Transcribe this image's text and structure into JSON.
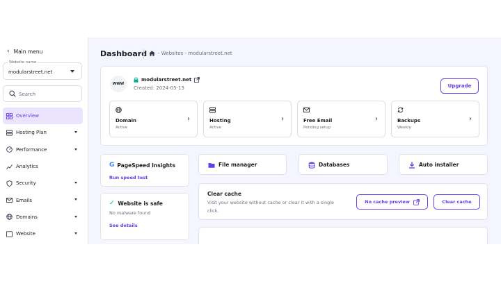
{
  "sidebar": {
    "main_menu": "Main menu",
    "website_select": {
      "label": "Website name",
      "value": "modularstreet.net"
    },
    "search": {
      "placeholder": "Search"
    },
    "items": [
      {
        "label": "Overview",
        "icon": "grid-icon",
        "active": true,
        "expandable": false
      },
      {
        "label": "Hosting Plan",
        "icon": "server-icon",
        "active": false,
        "expandable": true
      },
      {
        "label": "Performance",
        "icon": "gauge-icon",
        "active": false,
        "expandable": true
      },
      {
        "label": "Analytics",
        "icon": "chart-icon",
        "active": false,
        "expandable": false
      },
      {
        "label": "Security",
        "icon": "shield-icon",
        "active": false,
        "expandable": true
      },
      {
        "label": "Emails",
        "icon": "mail-icon",
        "active": false,
        "expandable": true
      },
      {
        "label": "Domains",
        "icon": "globe-icon",
        "active": false,
        "expandable": true
      },
      {
        "label": "Website",
        "icon": "window-icon",
        "active": false,
        "expandable": true
      }
    ]
  },
  "header": {
    "title": "Dashboard",
    "breadcrumb": "- Websites - modularstreet.net"
  },
  "site": {
    "logo_text": "WWW",
    "domain": "modularstreet.net",
    "created": "Created: 2024-05-13",
    "upgrade_label": "Upgrade"
  },
  "tiles": [
    {
      "name": "Domain",
      "status": "Active",
      "icon": "globe-icon"
    },
    {
      "name": "Hosting",
      "status": "Active",
      "icon": "server-icon"
    },
    {
      "name": "Free Email",
      "status": "Pending setup",
      "icon": "mail-icon"
    },
    {
      "name": "Backups",
      "status": "Weekly",
      "icon": "refresh-icon"
    }
  ],
  "pagespeed": {
    "title": "PageSpeed Insights",
    "link": "Run speed test"
  },
  "safety": {
    "title": "Website is safe",
    "subtitle": "No malware found",
    "link": "See details"
  },
  "tools": {
    "file_manager": "File manager",
    "databases": "Databases",
    "auto_installer": "Auto installer"
  },
  "cache": {
    "title": "Clear cache",
    "description": "Visit your website without cache or clear it with a single click.",
    "preview_label": "No cache preview",
    "clear_label": "Clear cache"
  },
  "colors": {
    "accent": "#673de6",
    "success": "#00b090",
    "background": "#f4f5ff"
  }
}
